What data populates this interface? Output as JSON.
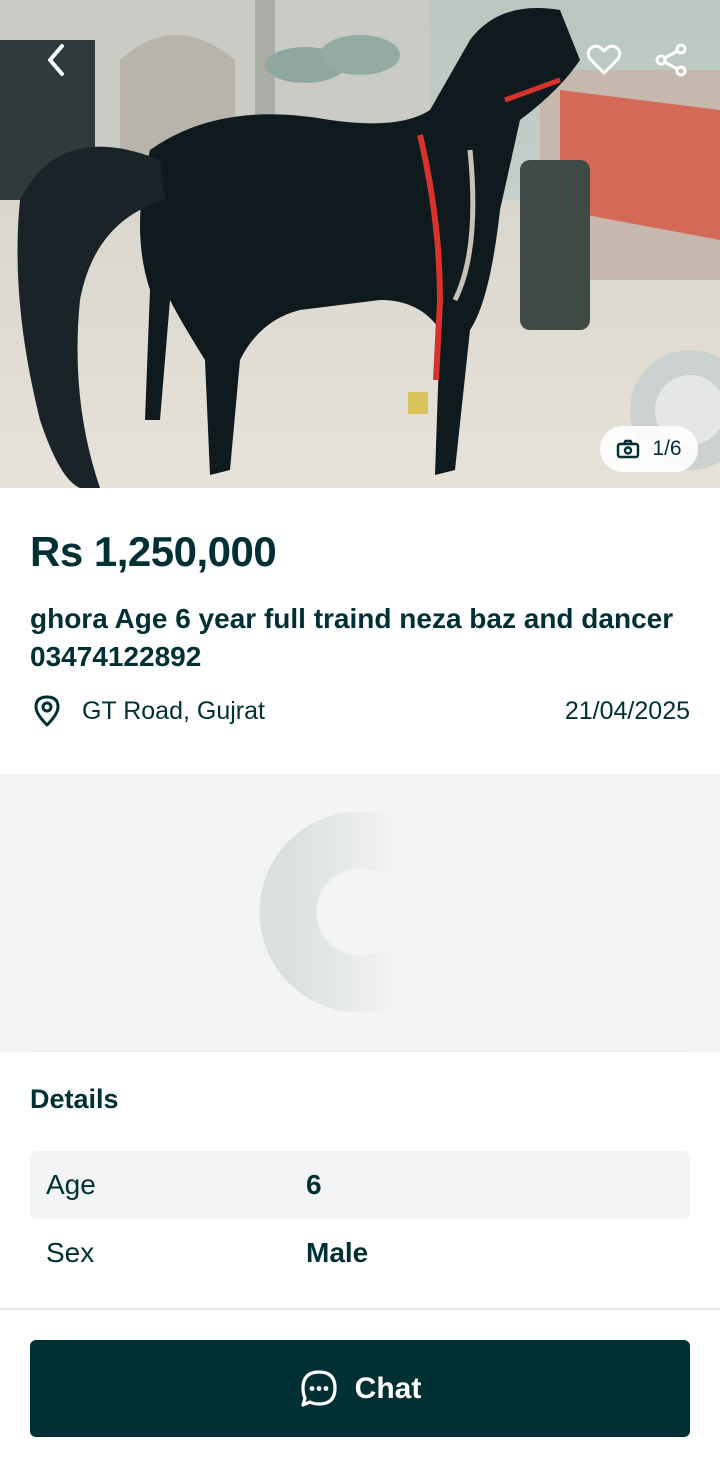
{
  "gallery": {
    "image_alt": "Black horse",
    "counter": "1/6",
    "back_icon": "chevron-left-icon",
    "favorite_icon": "heart-icon",
    "share_icon": "share-icon",
    "camera_icon": "camera-icon"
  },
  "listing": {
    "price": "Rs 1,250,000",
    "title": "ghora Age 6 year full traind neza baz and dancer 03474122892",
    "location": "GT Road, Gujrat",
    "location_icon": "map-pin-icon",
    "date": "21/04/2025"
  },
  "details": {
    "heading": "Details",
    "rows": [
      {
        "label": "Age",
        "value": "6"
      },
      {
        "label": "Sex",
        "value": "Male"
      }
    ]
  },
  "actions": {
    "chat_label": "Chat",
    "chat_icon": "chat-bubble-icon"
  },
  "colors": {
    "brand_dark": "#002f34",
    "panel_bg": "#f2f4f5",
    "white": "#ffffff"
  }
}
